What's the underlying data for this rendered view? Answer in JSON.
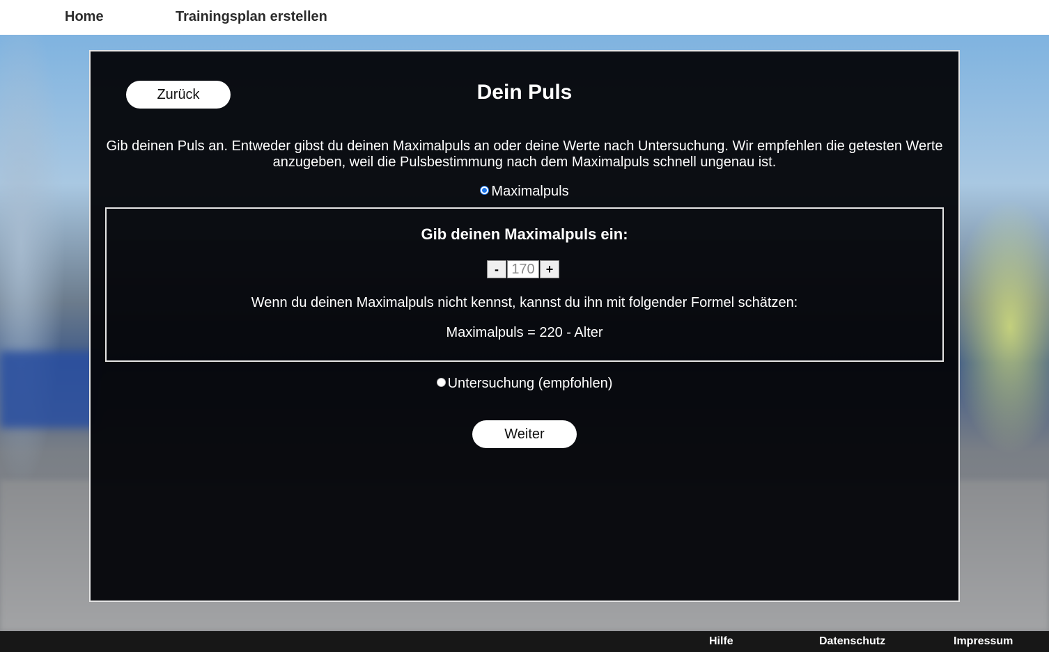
{
  "nav": {
    "home": "Home",
    "create_plan": "Trainingsplan erstellen"
  },
  "page": {
    "back_button": "Zurück",
    "title": "Dein Puls",
    "intro": "Gib deinen Puls an. Entweder gibst du deinen Maximalpuls an oder deine Werte nach Untersuchung. Wir empfehlen die getesten Werte anzugeben, weil die Pulsbestimmung nach dem Maximalpuls schnell ungenau ist.",
    "option_max": {
      "label": "Maximalpuls",
      "selected": true
    },
    "max_box": {
      "title": "Gib deinen Maximalpuls ein:",
      "minus": "-",
      "plus": "+",
      "value": "170",
      "hint": "Wenn du deinen Maximalpuls nicht kennst, kannst du ihn mit folgender Formel schätzen:",
      "formula": "Maximalpuls = 220 - Alter"
    },
    "option_exam": {
      "label": "Untersuchung (empfohlen)",
      "selected": false
    },
    "next_button": "Weiter"
  },
  "footer": {
    "help": "Hilfe",
    "privacy": "Datenschutz",
    "imprint": "Impressum"
  },
  "colors": {
    "panel": "#05060a",
    "button": "#ffffff",
    "radio_accent": "#1a73e8",
    "footer": "#171717"
  }
}
